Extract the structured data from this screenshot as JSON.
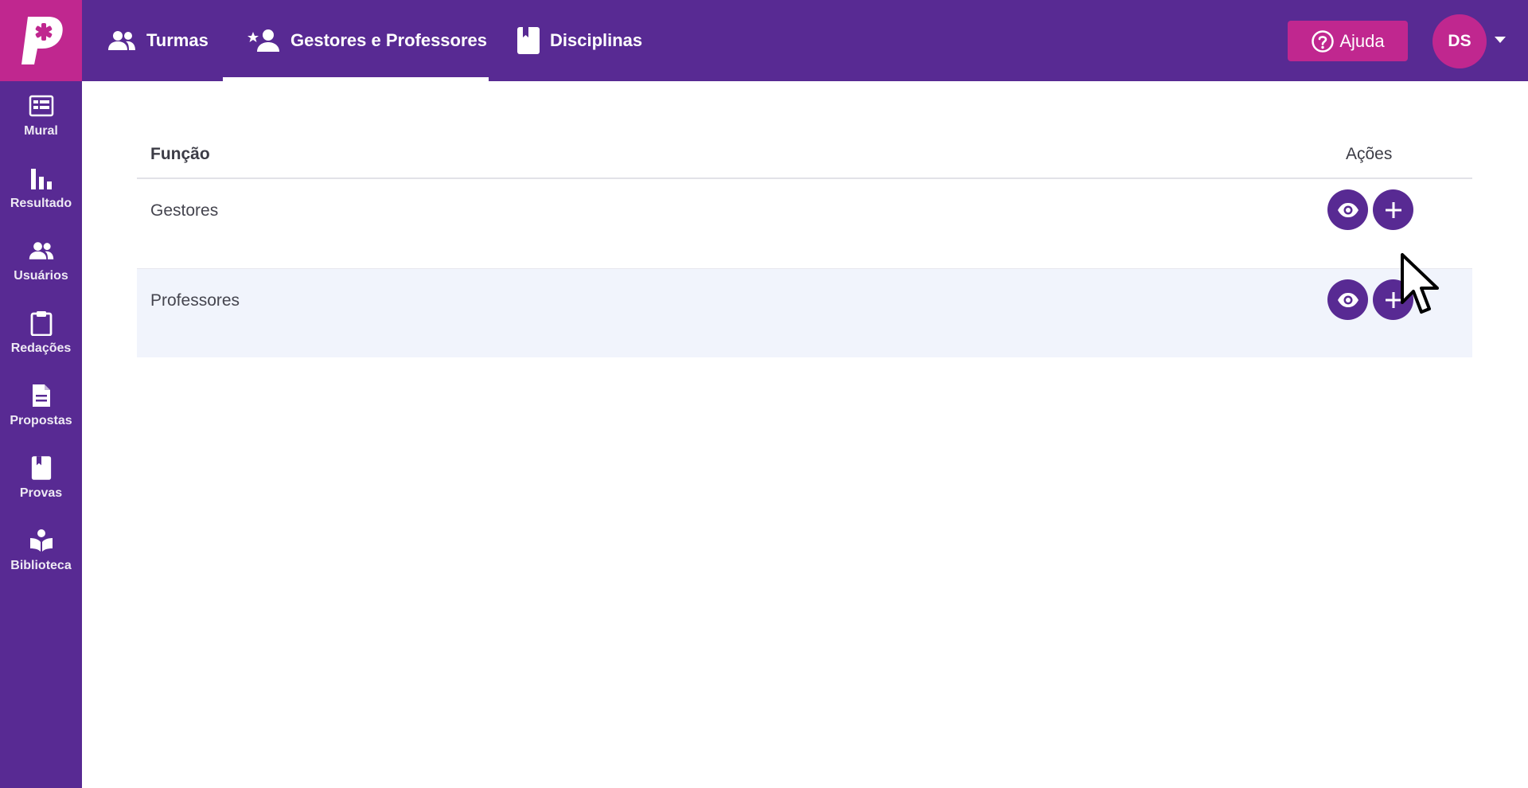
{
  "header": {
    "tabs": [
      {
        "label": "Turmas",
        "icon": "users-icon"
      },
      {
        "label": "Gestores e Professores",
        "icon": "user-star-icon",
        "active": true
      },
      {
        "label": "Disciplinas",
        "icon": "book-icon"
      }
    ],
    "help_label": "Ajuda",
    "avatar_initials": "DS"
  },
  "sidebar": {
    "items": [
      {
        "label": "Mural",
        "icon": "board-icon"
      },
      {
        "label": "Resultado",
        "icon": "bar-chart-icon"
      },
      {
        "label": "Usuários",
        "icon": "users-icon"
      },
      {
        "label": "Redações",
        "icon": "clipboard-icon"
      },
      {
        "label": "Propostas",
        "icon": "document-icon"
      },
      {
        "label": "Provas",
        "icon": "book-icon"
      },
      {
        "label": "Biblioteca",
        "icon": "reader-icon"
      }
    ]
  },
  "table": {
    "headers": {
      "funcao": "Função",
      "acoes": "Ações"
    },
    "rows": [
      {
        "name": "Gestores"
      },
      {
        "name": "Professores"
      }
    ]
  },
  "colors": {
    "primary": "#582a93",
    "accent": "#c0278f",
    "row_highlight": "#f1f4fc"
  }
}
